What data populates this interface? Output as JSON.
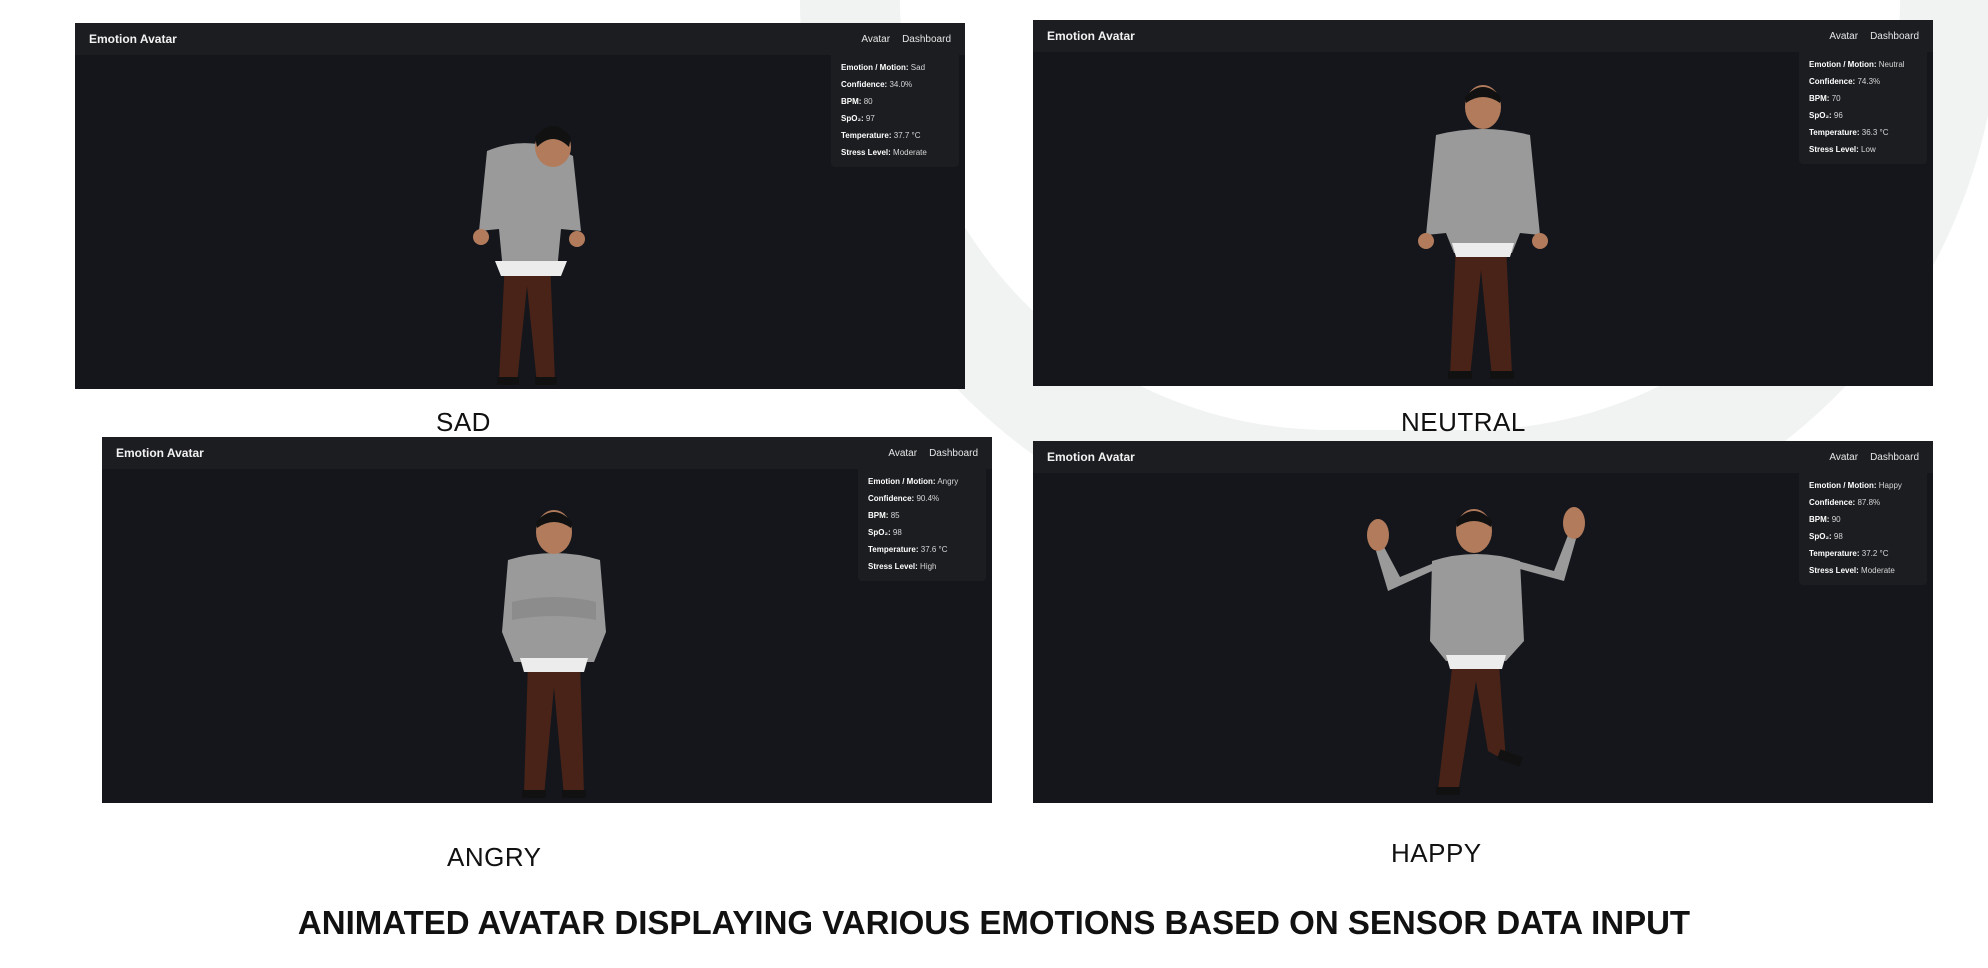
{
  "panels": [
    {
      "app_title": "Emotion Avatar",
      "nav": [
        "Avatar",
        "Dashboard"
      ],
      "stats": [
        {
          "label": "Emotion / Motion:",
          "value": "Sad"
        },
        {
          "label": "Confidence:",
          "value": "34.0%"
        },
        {
          "label": "BPM:",
          "value": "80"
        },
        {
          "label": "SpO₂:",
          "value": "97"
        },
        {
          "label": "Temperature:",
          "value": "37.7 °C"
        },
        {
          "label": "Stress Level:",
          "value": "Moderate"
        }
      ],
      "caption": "SAD"
    },
    {
      "app_title": "Emotion Avatar",
      "nav": [
        "Avatar",
        "Dashboard"
      ],
      "stats": [
        {
          "label": "Emotion / Motion:",
          "value": "Neutral"
        },
        {
          "label": "Confidence:",
          "value": "74.3%"
        },
        {
          "label": "BPM:",
          "value": "70"
        },
        {
          "label": "SpO₂:",
          "value": "96"
        },
        {
          "label": "Temperature:",
          "value": "36.3 °C"
        },
        {
          "label": "Stress Level:",
          "value": "Low"
        }
      ],
      "caption": "NEUTRAL"
    },
    {
      "app_title": "Emotion Avatar",
      "nav": [
        "Avatar",
        "Dashboard"
      ],
      "stats": [
        {
          "label": "Emotion / Motion:",
          "value": "Angry"
        },
        {
          "label": "Confidence:",
          "value": "90.4%"
        },
        {
          "label": "BPM:",
          "value": "85"
        },
        {
          "label": "SpO₂:",
          "value": "98"
        },
        {
          "label": "Temperature:",
          "value": "37.6 °C"
        },
        {
          "label": "Stress Level:",
          "value": "High"
        }
      ],
      "caption": "ANGRY"
    },
    {
      "app_title": "Emotion Avatar",
      "nav": [
        "Avatar",
        "Dashboard"
      ],
      "stats": [
        {
          "label": "Emotion / Motion:",
          "value": "Happy"
        },
        {
          "label": "Confidence:",
          "value": "87.8%"
        },
        {
          "label": "BPM:",
          "value": "90"
        },
        {
          "label": "SpO₂:",
          "value": "98"
        },
        {
          "label": "Temperature:",
          "value": "37.2 °C"
        },
        {
          "label": "Stress Level:",
          "value": "Moderate"
        }
      ],
      "caption": "HAPPY"
    }
  ],
  "figure_title": "ANIMATED AVATAR DISPLAYING VARIOUS EMOTIONS BASED ON SENSOR DATA INPUT"
}
